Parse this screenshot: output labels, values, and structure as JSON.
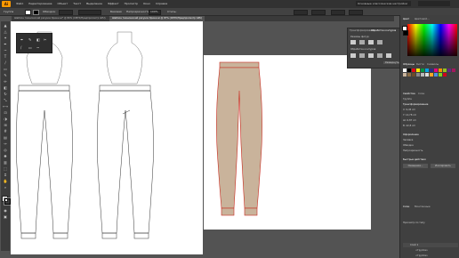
{
  "app": {
    "name": "Ai"
  },
  "menu": [
    "Файл",
    "Редактирование",
    "Объект",
    "Текст",
    "Выделение",
    "Эффект",
    "Просмотр",
    "Окно",
    "Справка"
  ],
  "workspace": {
    "label": "Основные классические настройки"
  },
  "control": {
    "selection": "Группа",
    "stroke_label": "Обводка:",
    "style_label": "Базовая",
    "opacity_label": "Непрозрачность:",
    "opacity": "100%",
    "style2": "Стиль:"
  },
  "tabs": [
    {
      "label": "Шаблон технический рисунок брюки.ai* @ 80% (CMYK/Предпросмотр GPU)",
      "active": false
    },
    {
      "label": "Шаблон технический рисунок брюки.ai @ 87% (CMYK/Предпросмотр GPU)",
      "active": true
    }
  ],
  "floatpanel2": {
    "tabs": [
      "Трансформирование",
      "Обработка контуров"
    ],
    "row1": "Режимы фигур:",
    "row2": "Обработка контуров:",
    "button": "Развернуть"
  },
  "rightpanel": {
    "color_tabs": [
      "Цвет",
      "Цветовой..."
    ],
    "swatch_tabs": [
      "Образцы",
      "Кисти",
      "Символы"
    ],
    "props_tabs": [
      "Свойства",
      "Слои"
    ],
    "group_label": "Группа",
    "transform_title": "Трансформирование",
    "x": "X: 9,45 cm",
    "y": "Y: 14,78 cm",
    "w": "Ш: 6,87 cm",
    "h": "В: 42,8 cm",
    "appearance_title": "Оформление",
    "fill_label": "Заливка",
    "stroke_label": "Обводка",
    "opacity_label": "Непрозрачность",
    "quick_title": "Быстрые действия",
    "btn1": "Смещение...",
    "btn2": "Изолировать",
    "layers_tabs": [
      "Слои",
      "Монтажные"
    ],
    "preview_label": "Просмотр по типу",
    "layer1": "Слой 1",
    "layer_sub": "<Группа>"
  },
  "colors": {
    "accent": "#ff9a00",
    "pants_fill": "#c9b39b",
    "pants_stroke": "#c82a1e"
  }
}
